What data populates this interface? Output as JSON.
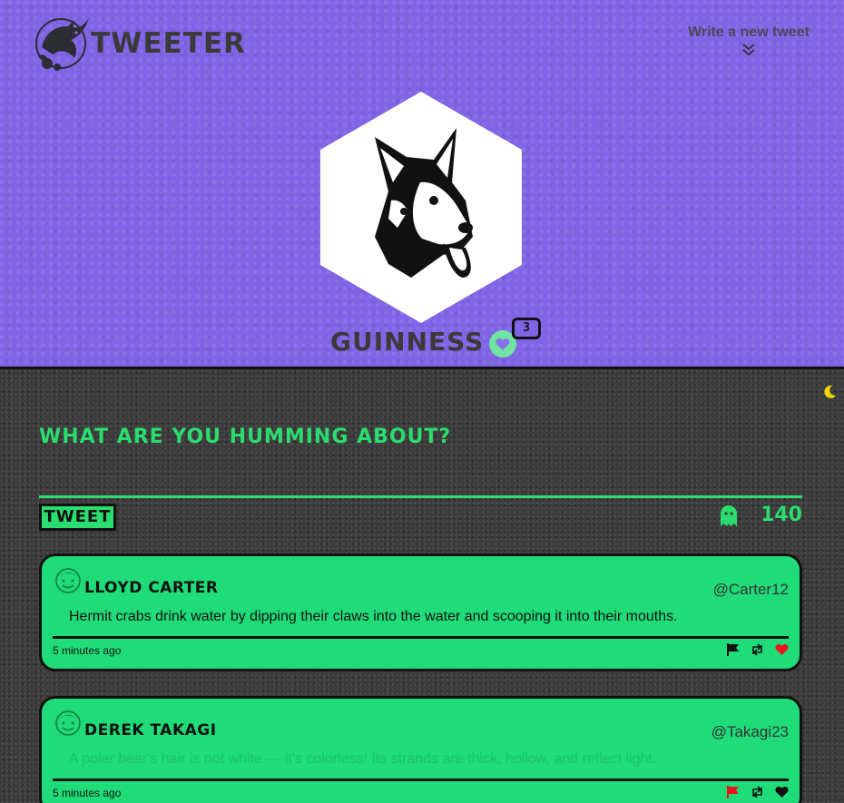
{
  "header": {
    "app_name": "Tweeter",
    "write_link": "Write  a new tweet",
    "profile_name": "Guinness",
    "likes_count": "3"
  },
  "compose": {
    "prompt": "What are you humming about?",
    "tweet_button": "Tweet",
    "char_count": "140"
  },
  "tweets": [
    {
      "name": "Lloyd Carter",
      "handle": "@Carter12",
      "text": "Hermit crabs drink water by dipping their claws into the water and scooping it into their mouths.",
      "time": "5 minutes ago",
      "flag_color": "#111111",
      "heart_color": "#e8141e"
    },
    {
      "name": "Derek Takagi",
      "handle": "@Takagi23",
      "text": "A polar bear's hair is not white — it's colorless! Its strands are thick, hollow, and reflect light.",
      "time": "5 minutes ago",
      "flag_color": "#e8141e",
      "heart_color": "#111111"
    }
  ],
  "colors": {
    "header_bg": "#8064e6",
    "accent_green": "#2bdc6e",
    "card_bg": "#20dc78",
    "moon": "#f5d400"
  },
  "icons": {
    "logo": "bird-flower-logo-icon",
    "write": "double-chevron-down-icon",
    "moon": "moon-icon",
    "ghost": "ghost-icon",
    "flag": "flag-icon",
    "retweet": "retweet-icon",
    "like": "heart-icon"
  }
}
